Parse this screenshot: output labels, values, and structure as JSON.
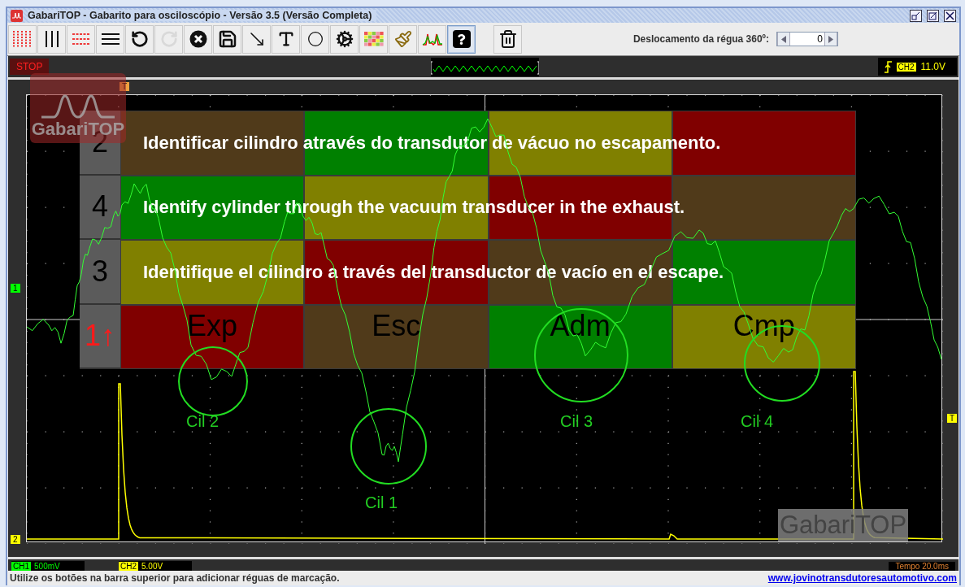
{
  "window": {
    "title": "GabariTOP - Gabarito para osciloscópio - Versão 3.5 (Versão Completa)"
  },
  "toolbar": {
    "tools": [
      {
        "kind": "vrulers-red",
        "disabled": false,
        "pressed": false
      },
      {
        "kind": "vrulers",
        "disabled": false,
        "pressed": false
      },
      {
        "kind": "hrulers-red",
        "disabled": false,
        "pressed": false
      },
      {
        "kind": "hrulers",
        "disabled": false,
        "pressed": false
      },
      {
        "kind": "undo",
        "disabled": false,
        "pressed": false
      },
      {
        "kind": "redo",
        "disabled": true,
        "pressed": false
      },
      {
        "kind": "clear",
        "disabled": false,
        "pressed": false
      },
      {
        "kind": "save",
        "disabled": false,
        "pressed": false
      },
      {
        "kind": "arrow",
        "disabled": false,
        "pressed": false
      },
      {
        "kind": "text",
        "disabled": false,
        "pressed": false
      },
      {
        "kind": "circle",
        "disabled": false,
        "pressed": false
      },
      {
        "kind": "settings",
        "disabled": false,
        "pressed": false
      },
      {
        "kind": "colors",
        "disabled": false,
        "pressed": false
      },
      {
        "kind": "brush",
        "disabled": false,
        "pressed": false
      },
      {
        "kind": "waveform",
        "disabled": false,
        "pressed": false
      },
      {
        "kind": "help",
        "disabled": false,
        "pressed": true
      },
      {
        "kind": "gap"
      },
      {
        "kind": "delete",
        "disabled": false,
        "pressed": false
      }
    ],
    "offset": {
      "label": "Deslocamento da régua 360º:",
      "value": "0"
    }
  },
  "scope": {
    "run_state": "STOP",
    "logo": "GabariTOP",
    "trigger": {
      "channel": "CH2",
      "level": "11.0V"
    },
    "markers": [
      {
        "kind": "trigger-top",
        "text": "T",
        "color": "#f0a040"
      },
      {
        "kind": "ch1",
        "text": "1",
        "color": "#00ff00"
      },
      {
        "kind": "ch2",
        "text": "2",
        "color": "#ffff00"
      },
      {
        "kind": "trigger-level",
        "text": "T",
        "color": "#ffff00"
      }
    ],
    "template": {
      "rows": [
        {
          "number": "2",
          "highlighted": false,
          "caption": "Identificar cilindro através do transdutor de vácuo no escapamento.",
          "cells": [
            {
              "color": "#503a1a"
            },
            {
              "color": "#008000"
            },
            {
              "color": "#808000"
            },
            {
              "color": "#800000"
            }
          ]
        },
        {
          "number": "4",
          "highlighted": false,
          "caption": "Identify cylinder through the vacuum transducer in the exhaust.",
          "cells": [
            {
              "color": "#008000"
            },
            {
              "color": "#808000"
            },
            {
              "color": "#800000"
            },
            {
              "color": "#503a1a"
            }
          ]
        },
        {
          "number": "3",
          "highlighted": false,
          "caption": "Identifique el cilindro a través del transductor de vacío en el escape.",
          "cells": [
            {
              "color": "#808000"
            },
            {
              "color": "#800000"
            },
            {
              "color": "#503a1a"
            },
            {
              "color": "#008000"
            }
          ]
        },
        {
          "number": "1↑",
          "highlighted": true,
          "cells": [
            {
              "color": "#800000",
              "label": "Exp"
            },
            {
              "color": "#503a1a",
              "label": "Esc"
            },
            {
              "color": "#008000",
              "label": "Adm"
            },
            {
              "color": "#808000",
              "label": "Cmp"
            }
          ]
        }
      ]
    },
    "cylinders": [
      {
        "label": "Cil 2"
      },
      {
        "label": "Cil 1"
      },
      {
        "label": "Cil 3"
      },
      {
        "label": "Cil 4"
      }
    ],
    "watermark": "GabariTOP",
    "channels": [
      {
        "name": "CH1",
        "scale": "500mV",
        "color": "#00ff00"
      },
      {
        "name": "CH2",
        "scale": "5.00V",
        "color": "#ffff00"
      }
    ],
    "timebase": "Tempo 20.0ms"
  },
  "status_bar": {
    "message": "Utilize os botões na barra superior para adicionar réguas de marcação.",
    "link": "www.jovinotransdutoresautomotivo.com"
  }
}
